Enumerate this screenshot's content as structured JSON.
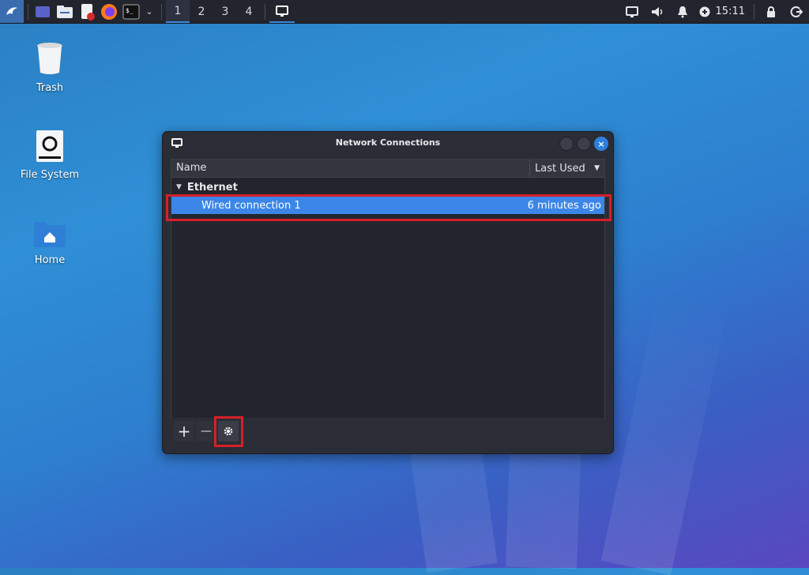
{
  "taskbar": {
    "workspaces": [
      "1",
      "2",
      "3",
      "4"
    ],
    "active_workspace": "1",
    "clock": "15:11",
    "accent": "#3b8be0"
  },
  "desktop": {
    "icons": [
      {
        "label": "Trash",
        "icon": "trash-icon"
      },
      {
        "label": "File System",
        "icon": "drive-icon"
      },
      {
        "label": "Home",
        "icon": "home-folder-icon"
      }
    ]
  },
  "window": {
    "title": "Network Connections",
    "columns": {
      "name": "Name",
      "last_used": "Last Used"
    },
    "group": "Ethernet",
    "connection": {
      "name": "Wired connection 1",
      "last_used": "6 minutes ago"
    },
    "buttons": {
      "add": "+",
      "remove": "—"
    },
    "selection_color": "#3b86e6",
    "highlight_color": "#d4202a"
  }
}
